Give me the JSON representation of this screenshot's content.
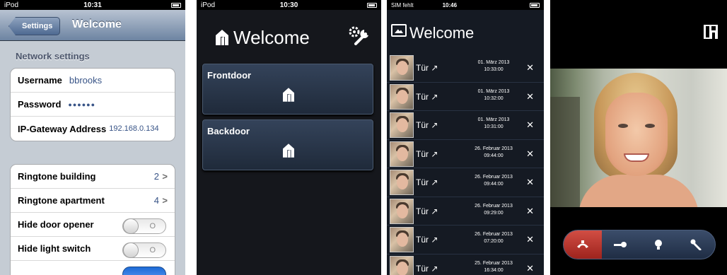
{
  "phone1": {
    "status": {
      "carrier": "iPod",
      "time": "10:31"
    },
    "back_label": "Settings",
    "title": "Welcome",
    "network_header": "Network settings",
    "network": [
      {
        "label": "Username",
        "value": "bbrooks"
      },
      {
        "label": "Password",
        "value": "●●●●●●"
      },
      {
        "label": "IP-Gateway Address",
        "value": "192.168.0.134"
      }
    ],
    "ringtones": [
      {
        "label": "Ringtone building",
        "value": "2"
      },
      {
        "label": "Ringtone apartment",
        "value": "4"
      }
    ],
    "toggles": [
      {
        "label": "Hide door opener",
        "state_text": "O"
      },
      {
        "label": "Hide light switch",
        "state_text": "O"
      }
    ]
  },
  "phone2": {
    "status": {
      "carrier": "iPod",
      "time": "10:30"
    },
    "title": "Welcome",
    "doors": [
      {
        "name": "Frontdoor"
      },
      {
        "name": "Backdoor"
      }
    ]
  },
  "phone3": {
    "status": {
      "carrier": "SIM fehlt",
      "time": "10:46"
    },
    "title": "Welcome",
    "entries": [
      {
        "label": "Tür",
        "date": "01. März 2013",
        "time": "10:33:00"
      },
      {
        "label": "Tür",
        "date": "01. März 2013",
        "time": "10:32:00"
      },
      {
        "label": "Tür",
        "date": "01. März 2013",
        "time": "10:31:00"
      },
      {
        "label": "Tür",
        "date": "26. Februar 2013",
        "time": "09:44:00"
      },
      {
        "label": "Tür",
        "date": "26. Februar 2013",
        "time": "09:44:00"
      },
      {
        "label": "Tür",
        "date": "26. Februar 2013",
        "time": "09:29:00"
      },
      {
        "label": "Tür",
        "date": "26. Februar 2013",
        "time": "07:20:00"
      },
      {
        "label": "Tür",
        "date": "25. Februar 2013",
        "time": "16:34:00"
      }
    ],
    "arrow": "↗",
    "delete": "✕"
  },
  "phone4": {
    "controls": [
      "hang-up",
      "door-opener",
      "light",
      "mute"
    ]
  },
  "colors": {
    "ios_nav": "#6d84a2",
    "ios_value": "#385487",
    "dark_bg": "#15171c",
    "button_blue": "#2a3850",
    "hangup_red": "#c03a31"
  }
}
